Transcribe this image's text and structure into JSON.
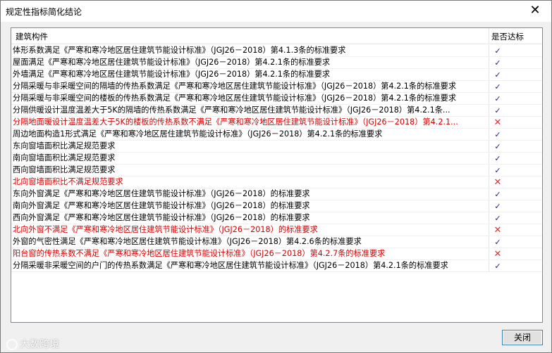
{
  "window": {
    "title": "规定性指标简化结论",
    "close_glyph": "✕"
  },
  "table": {
    "headers": {
      "name": "建筑构件",
      "status": "是否达标"
    },
    "rows": [
      {
        "name": "体形系数满足《严寒和寒冷地区居住建筑节能设计标准》（JGJ26－2018）第4.1.3条的标准要求",
        "ok": true
      },
      {
        "name": "屋面满足《严寒和寒冷地区居住建筑节能设计标准》（JGJ26－2018）第4.2.1条的标准要求",
        "ok": true
      },
      {
        "name": "外墙满足《严寒和寒冷地区居住建筑节能设计标准》（JGJ26－2018）第4.2.1条的标准要求",
        "ok": true
      },
      {
        "name": "分隔采暖与非采暖空间的隔墙的传热系数满足《严寒和寒冷地区居住建筑节能设计标准》（JGJ26－2018）第4.2.1条的标准要求",
        "ok": true
      },
      {
        "name": "分隔采暖与非采暖空间的楼板的传热系数满足《严寒和寒冷地区居住建筑节能设计标准》（JGJ26－2018）第4.2.1条的标准要求",
        "ok": true
      },
      {
        "name": "分隔供暖设计温度温差大于5K的隔墙的传热系数满足《严寒和寒冷地区居住建筑节能设计标准》（JGJ26－2018）第4.2.1条...",
        "ok": true
      },
      {
        "name": "分隔地面暖设计温度温差大于5K的楼板的传热系数不满足《严寒和寒冷地区居住建筑节能设计标准》（JGJ26－2018）第4.2.1...",
        "ok": false
      },
      {
        "name": "周边地面构造1形式满足《严寒和寒冷地区居住建筑节能设计标准》（JGJ26－2018）第4.2.1条的标准要求",
        "ok": true
      },
      {
        "name": "东向窗墙面积比满足规范要求",
        "ok": true
      },
      {
        "name": "南向窗墙面积比满足规范要求",
        "ok": true
      },
      {
        "name": "西向窗墙面积比满足规范要求",
        "ok": true
      },
      {
        "name": "北向窗墙面积比不满足规范要求",
        "ok": false
      },
      {
        "name": "东向外窗满足《严寒和寒冷地区居住建筑节能设计标准》（JGJ26－2018）的标准要求",
        "ok": true
      },
      {
        "name": "南向外窗满足《严寒和寒冷地区居住建筑节能设计标准》（JGJ26－2018）的标准要求",
        "ok": true
      },
      {
        "name": "西向外窗满足《严寒和寒冷地区居住建筑节能设计标准》（JGJ26－2018）的标准要求",
        "ok": true
      },
      {
        "name": "北向外窗不满足《严寒和寒冷地区居住建筑节能设计标准》（JGJ26－2018）的标准要求",
        "ok": false
      },
      {
        "name": "外窗的气密性满足《严寒和寒冷地区居住建筑节能设计标准》（JGJ26－2018）第4.2.6条的标准要求",
        "ok": true
      },
      {
        "name": "阳台窗的传热系数不满足《严寒和寒冷地区居住建筑节能设计标准》（JGJ26－2018）第4.2.7条的标准要求",
        "ok": false
      },
      {
        "name": "分隔采暖非采暖空间的户门的传热系数满足《严寒和寒冷地区居住建筑节能设计标准》（JGJ26－2018）第4.2.1条的标准要求",
        "ok": true
      }
    ],
    "ok_glyph": "✓",
    "fail_glyph": "✕"
  },
  "buttons": {
    "close_label": "关闭"
  },
  "watermark": {
    "text": "大数跨境"
  },
  "colors": {
    "fail_text": "#d40000",
    "ok_mark": "#1a1a8a",
    "fail_mark": "#e03030"
  }
}
